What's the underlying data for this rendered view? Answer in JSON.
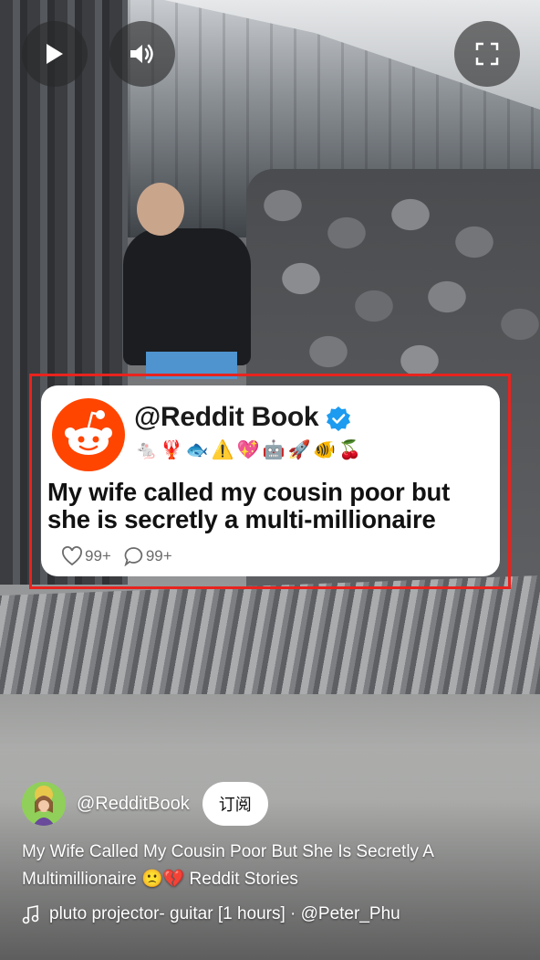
{
  "controls": {
    "play_icon": "play-icon",
    "volume_icon": "volume-icon",
    "fullscreen_icon": "fullscreen-icon"
  },
  "overlay_card": {
    "handle": "@Reddit Book",
    "awards": [
      "🐁",
      "🦞",
      "🐟",
      "⚠️",
      "💖",
      "🤖",
      "🚀",
      "🐠",
      "🍒"
    ],
    "title": "My wife called my cousin poor but she is secretly a multi-millionaire",
    "likes": "99+",
    "comments": "99+",
    "logo_color": "#ff4500",
    "highlight_color": "#e8231e"
  },
  "channel": {
    "name": "@RedditBook",
    "subscribe_label": "订阅"
  },
  "video": {
    "title_text": "My Wife Called My Cousin Poor But She Is Secretly A Multimillionaire",
    "title_emojis": "🙁💔",
    "title_suffix": "Reddit Stories"
  },
  "music": {
    "track": "pluto projector- guitar [1 hours] · @Peter_Phu"
  }
}
